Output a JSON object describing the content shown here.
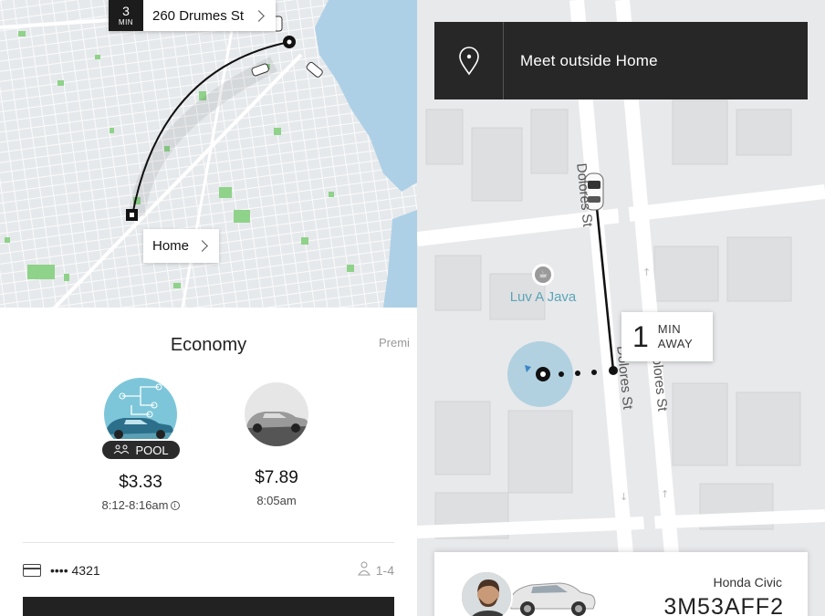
{
  "left": {
    "eta_chip": {
      "number": "3",
      "unit": "MIN",
      "destination": "260 Drumes St"
    },
    "home_chip": {
      "label": "Home"
    },
    "sheet": {
      "tier_title": "Economy",
      "next_tier_peek": "Premi",
      "options": [
        {
          "badge": "POOL",
          "price": "$3.33",
          "time": "8:12-8:16am",
          "has_info": true
        },
        {
          "badge": "",
          "price": "$7.89",
          "time": "8:05am",
          "has_info": false
        }
      ],
      "payment": {
        "card": "•••• 4321",
        "capacity": "1-4"
      }
    }
  },
  "right": {
    "banner": {
      "text": "Meet outside Home",
      "icon": "location-pin-icon"
    },
    "streets": [
      "Dolores St",
      "Dolores St",
      "Dolores St"
    ],
    "poi": {
      "name": "Luv A Java",
      "icon": "coffee-icon"
    },
    "eta": {
      "number": "1",
      "line1": "MIN",
      "line2": "AWAY"
    },
    "driver": {
      "car_model": "Honda Civic",
      "plate": "3M53AFF2"
    }
  },
  "colors": {
    "water": "#aed0e6",
    "park": "#8fd28a",
    "pool_accent": "#7dc6d9",
    "poi_text": "#5aa4b8",
    "dark": "#272727"
  }
}
